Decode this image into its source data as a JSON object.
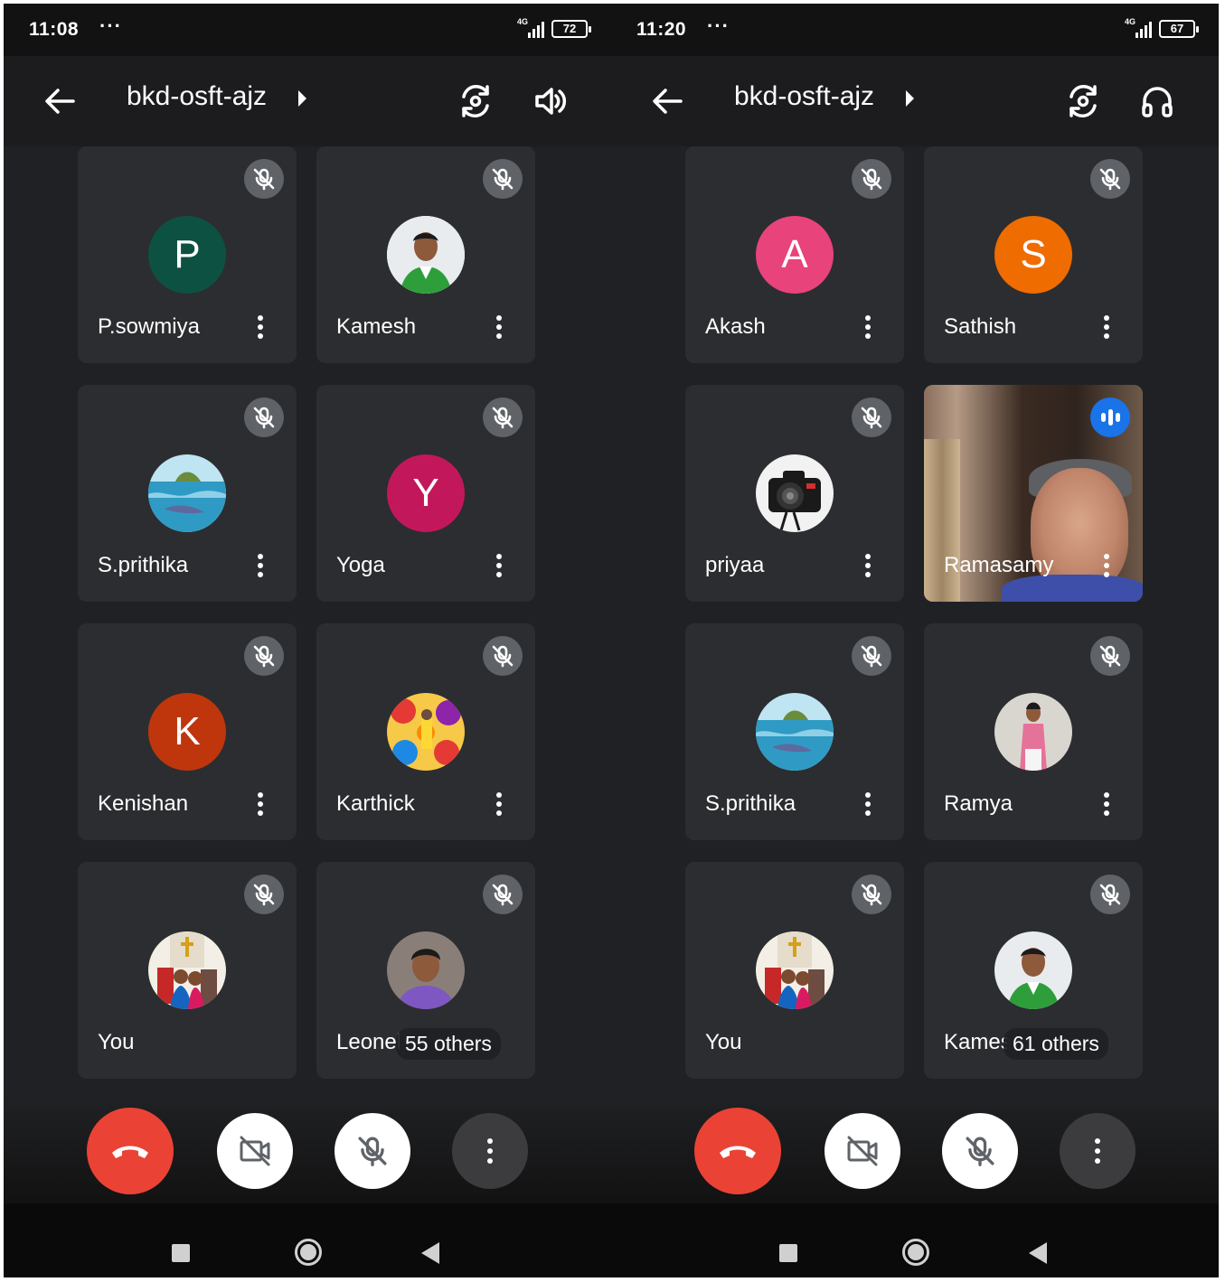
{
  "screens": [
    {
      "status": {
        "time": "11:08",
        "dots": "···",
        "network": "4G",
        "battery": "72"
      },
      "header": {
        "title": "bkd-osft-ajz",
        "back_icon": "arrow-left-icon",
        "icon1": "camera-flip-icon",
        "icon2": "speaker-icon"
      },
      "participants": [
        {
          "name": "P.sowmiya",
          "initial": "P",
          "color": "#0d5142",
          "kind": "letter"
        },
        {
          "name": "Kamesh",
          "kind": "photo",
          "photo": "green-shirt-man"
        },
        {
          "name": "S.prithika",
          "kind": "photo",
          "photo": "sea-dolphin"
        },
        {
          "name": "Yoga",
          "initial": "Y",
          "color": "#c2185b",
          "kind": "letter"
        },
        {
          "name": "Kenishan",
          "initial": "K",
          "color": "#bf360c",
          "kind": "letter"
        },
        {
          "name": "Karthick",
          "kind": "photo",
          "photo": "colorful-pattern"
        },
        {
          "name": "You",
          "kind": "photo",
          "photo": "church-couple"
        },
        {
          "name": "Leonel",
          "kind": "photo",
          "photo": "young-man",
          "others": "55 others"
        }
      ],
      "controls": {
        "end": "end-call-icon",
        "camera": "camera-off-icon",
        "mic": "mic-off-icon",
        "more": "more-vert-icon"
      }
    },
    {
      "status": {
        "time": "11:20",
        "dots": "···",
        "network": "4G",
        "battery": "67"
      },
      "header": {
        "title": "bkd-osft-ajz",
        "back_icon": "arrow-left-icon",
        "icon1": "camera-flip-icon",
        "icon2": "headphones-icon"
      },
      "participants": [
        {
          "name": "Akash",
          "initial": "A",
          "color": "#e8437a",
          "kind": "letter"
        },
        {
          "name": "Sathish",
          "initial": "S",
          "color": "#ef6c00",
          "kind": "letter"
        },
        {
          "name": "priyaa",
          "kind": "photo",
          "photo": "camera"
        },
        {
          "name": "Ramasamy",
          "kind": "video",
          "speaking": true
        },
        {
          "name": "S.prithika",
          "kind": "photo",
          "photo": "sea-dolphin"
        },
        {
          "name": "Ramya",
          "kind": "photo",
          "photo": "pink-dress-woman"
        },
        {
          "name": "You",
          "kind": "photo",
          "photo": "church-couple"
        },
        {
          "name": "Kamesh",
          "kind": "photo",
          "photo": "green-shirt-man",
          "others": "61 others"
        }
      ],
      "controls": {
        "end": "end-call-icon",
        "camera": "camera-off-icon",
        "mic": "mic-off-icon",
        "more": "more-vert-icon"
      }
    }
  ]
}
